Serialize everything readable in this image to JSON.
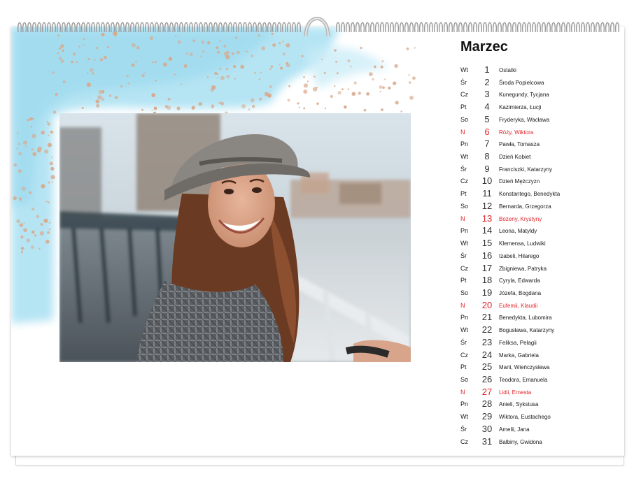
{
  "calendar": {
    "month": "Marzec",
    "days": [
      {
        "dow": "Wt",
        "day": "1",
        "names": "Ostatki",
        "sunday": false
      },
      {
        "dow": "Śr",
        "day": "2",
        "names": "Środa Popielcowa",
        "sunday": false
      },
      {
        "dow": "Cz",
        "day": "3",
        "names": "Kunegundy, Tycjana",
        "sunday": false
      },
      {
        "dow": "Pt",
        "day": "4",
        "names": "Kazimierza, Łucji",
        "sunday": false
      },
      {
        "dow": "So",
        "day": "5",
        "names": "Fryderyka, Wacława",
        "sunday": false
      },
      {
        "dow": "N",
        "day": "6",
        "names": "Róży, Wiktora",
        "sunday": true
      },
      {
        "dow": "Pn",
        "day": "7",
        "names": "Pawła, Tomasza",
        "sunday": false
      },
      {
        "dow": "Wt",
        "day": "8",
        "names": "Dzień Kobiet",
        "sunday": false
      },
      {
        "dow": "Śr",
        "day": "9",
        "names": "Franciszki, Katarzyny",
        "sunday": false
      },
      {
        "dow": "Cz",
        "day": "10",
        "names": "Dzień Mężczyzn",
        "sunday": false
      },
      {
        "dow": "Pt",
        "day": "11",
        "names": "Konstantego, Benedykta",
        "sunday": false
      },
      {
        "dow": "So",
        "day": "12",
        "names": "Bernarda, Grzegorza",
        "sunday": false
      },
      {
        "dow": "N",
        "day": "13",
        "names": "Bożeny, Krystyny",
        "sunday": true
      },
      {
        "dow": "Pn",
        "day": "14",
        "names": "Leona, Matyldy",
        "sunday": false
      },
      {
        "dow": "Wt",
        "day": "15",
        "names": "Klemensa, Ludwiki",
        "sunday": false
      },
      {
        "dow": "Śr",
        "day": "16",
        "names": "Izabeli, Hilarego",
        "sunday": false
      },
      {
        "dow": "Cz",
        "day": "17",
        "names": "Zbigniewa, Patryka",
        "sunday": false
      },
      {
        "dow": "Pt",
        "day": "18",
        "names": "Cyryla, Edwarda",
        "sunday": false
      },
      {
        "dow": "So",
        "day": "19",
        "names": "Józefa, Bogdana",
        "sunday": false
      },
      {
        "dow": "N",
        "day": "20",
        "names": "Eufemii, Klaudii",
        "sunday": true
      },
      {
        "dow": "Pn",
        "day": "21",
        "names": "Benedykta, Lubomira",
        "sunday": false
      },
      {
        "dow": "Wt",
        "day": "22",
        "names": "Bogusława, Katarzyny",
        "sunday": false
      },
      {
        "dow": "Śr",
        "day": "23",
        "names": "Feliksa, Pelagii",
        "sunday": false
      },
      {
        "dow": "Cz",
        "day": "24",
        "names": "Marka, Gabriela",
        "sunday": false
      },
      {
        "dow": "Pt",
        "day": "25",
        "names": "Marii, Wieńczysława",
        "sunday": false
      },
      {
        "dow": "So",
        "day": "26",
        "names": "Teodora, Emanuela",
        "sunday": false
      },
      {
        "dow": "N",
        "day": "27",
        "names": "Lidii, Ernesta",
        "sunday": true
      },
      {
        "dow": "Pn",
        "day": "28",
        "names": "Anieli, Sykstusa",
        "sunday": false
      },
      {
        "dow": "Wt",
        "day": "29",
        "names": "Wiktora, Eustachego",
        "sunday": false
      },
      {
        "dow": "Śr",
        "day": "30",
        "names": "Amelii, Jana",
        "sunday": false
      },
      {
        "dow": "Cz",
        "day": "31",
        "names": "Balbiny, Gwidona",
        "sunday": false
      }
    ]
  },
  "colors": {
    "sunday": "#e2252b",
    "watercolor": "#a9e0f2",
    "dots": "#d9a98c"
  },
  "icons": {
    "binding": "wire-binding-icon",
    "hanger": "hanger-hook-icon"
  }
}
